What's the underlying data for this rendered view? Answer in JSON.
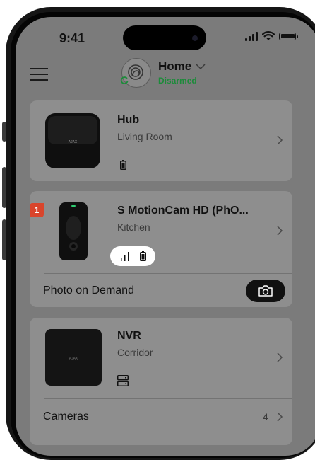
{
  "status_bar": {
    "time": "9:41"
  },
  "header": {
    "space_name": "Home",
    "security_state": "Disarmed"
  },
  "devices": [
    {
      "name": "Hub",
      "room": "Living Room",
      "logo": "AJAX"
    },
    {
      "name": "S MotionCam HD (PhO...",
      "room": "Kitchen",
      "alert_count": "1",
      "action_label": "Photo on Demand"
    },
    {
      "name": "NVR",
      "room": "Corridor",
      "logo": "AJAX",
      "row_label": "Cameras",
      "row_count": "4"
    }
  ],
  "colors": {
    "screen_bg": "#7b7b7b",
    "card_bg": "#8e8e8e",
    "disarmed_green": "#1c8b3a",
    "alert_red": "#d9452c"
  },
  "icons": [
    "menu-icon",
    "chevron-down-icon",
    "chevron-right-icon",
    "battery-icon",
    "signal-icon",
    "camera-icon",
    "ethernet-icon"
  ]
}
